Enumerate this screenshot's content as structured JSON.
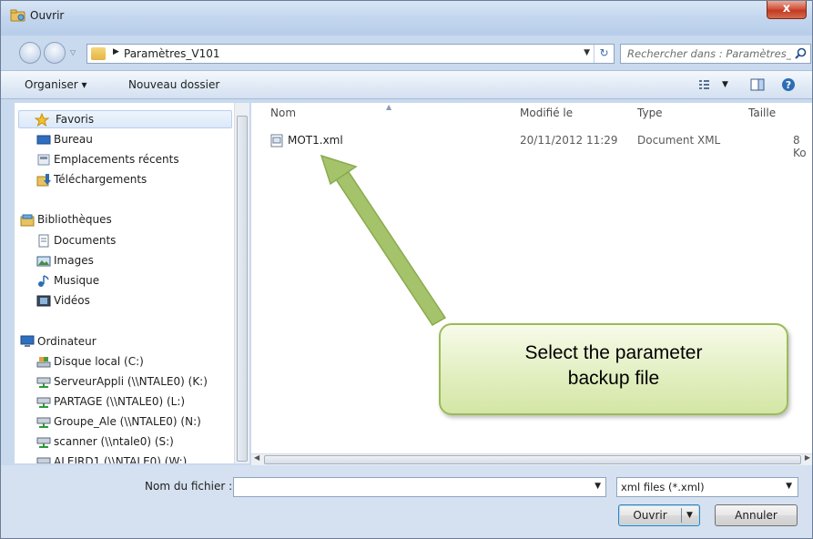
{
  "window": {
    "title": "Ouvrir",
    "close_label": "x"
  },
  "address_bar": {
    "path": "Paramètres_V101",
    "search_placeholder": "Rechercher dans : Paramètres_..."
  },
  "toolbar": {
    "organize_label": "Organiser ▾",
    "new_folder_label": "Nouveau dossier"
  },
  "sidebar": {
    "favorites": {
      "label": "Favoris",
      "items": [
        {
          "label": "Bureau",
          "icon": "desktop-icon"
        },
        {
          "label": "Emplacements récents",
          "icon": "recent-places-icon"
        },
        {
          "label": "Téléchargements",
          "icon": "downloads-icon"
        }
      ]
    },
    "libraries": {
      "label": "Bibliothèques",
      "items": [
        {
          "label": "Documents",
          "icon": "documents-icon"
        },
        {
          "label": "Images",
          "icon": "images-icon"
        },
        {
          "label": "Musique",
          "icon": "music-icon"
        },
        {
          "label": "Vidéos",
          "icon": "videos-icon"
        }
      ]
    },
    "computer": {
      "label": "Ordinateur",
      "items": [
        {
          "label": "Disque local (C:)",
          "icon": "local-disk-icon"
        },
        {
          "label": "ServeurAppli (\\\\NTALE0) (K:)",
          "icon": "network-drive-icon"
        },
        {
          "label": "PARTAGE (\\\\NTALE0) (L:)",
          "icon": "network-drive-icon"
        },
        {
          "label": "Groupe_Ale (\\\\NTALE0) (N:)",
          "icon": "network-drive-icon"
        },
        {
          "label": "scanner (\\\\ntale0) (S:)",
          "icon": "network-drive-icon"
        },
        {
          "label": "ALEIRD1 (\\\\NTALE0) (W:)",
          "icon": "network-drive-icon"
        }
      ]
    }
  },
  "file_list": {
    "columns": [
      "Nom",
      "Modifié le",
      "Type",
      "Taille"
    ],
    "rows": [
      {
        "name": "MOT1.xml",
        "modified": "20/11/2012 11:29",
        "type": "Document XML",
        "size": "8 Ko"
      }
    ]
  },
  "bottom": {
    "filename_label": "Nom du fichier :",
    "filename_value": "",
    "filter_value": "xml files (*.xml)",
    "open_label": "Ouvrir",
    "cancel_label": "Annuler"
  },
  "callout": {
    "line1": "Select the parameter",
    "line2": "backup file"
  },
  "colors": {
    "callout_fill": "#e2efc2",
    "callout_border": "#9bbb59",
    "arrow": "#9bbb59"
  }
}
